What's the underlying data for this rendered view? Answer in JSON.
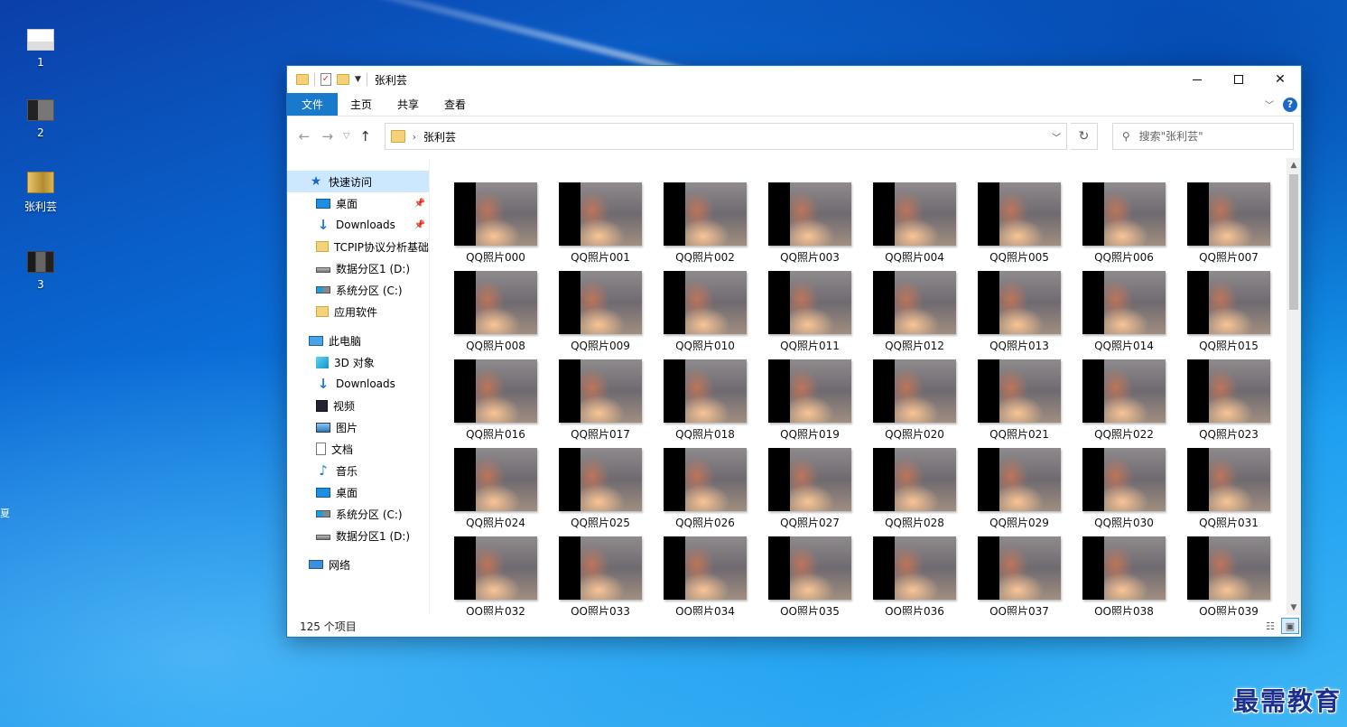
{
  "desktop": {
    "icons": [
      {
        "label": "1"
      },
      {
        "label": "2"
      },
      {
        "label": "张利芸"
      },
      {
        "label": "3"
      }
    ],
    "edge_text": [
      "夏"
    ],
    "watermark": "最需教育"
  },
  "window": {
    "title": "张利芸",
    "ribbon_tabs": [
      "文件",
      "主页",
      "共享",
      "查看"
    ],
    "help_label": "?",
    "address": {
      "path": "张利芸"
    },
    "search": {
      "placeholder": "搜索\"张利芸\""
    },
    "sidebar": {
      "quick_access": "快速访问",
      "quick_items": [
        {
          "label": "桌面",
          "icon": "desktop-icon",
          "pinned": true
        },
        {
          "label": "Downloads",
          "icon": "downloads-icon",
          "pinned": true
        },
        {
          "label": "TCPIP协议分析基础",
          "icon": "folder-icon",
          "pinned": false
        },
        {
          "label": "数据分区1 (D:)",
          "icon": "drive-icon",
          "pinned": false
        },
        {
          "label": "系统分区 (C:)",
          "icon": "system-drive-icon",
          "pinned": false
        },
        {
          "label": "应用软件",
          "icon": "folder-icon",
          "pinned": false
        }
      ],
      "this_pc": "此电脑",
      "pc_items": [
        {
          "label": "3D 对象",
          "icon": "3d-objects-icon"
        },
        {
          "label": "Downloads",
          "icon": "downloads-icon"
        },
        {
          "label": "视频",
          "icon": "video-icon"
        },
        {
          "label": "图片",
          "icon": "pictures-icon"
        },
        {
          "label": "文档",
          "icon": "documents-icon"
        },
        {
          "label": "音乐",
          "icon": "music-icon"
        },
        {
          "label": "桌面",
          "icon": "desktop-icon"
        },
        {
          "label": "系统分区 (C:)",
          "icon": "system-drive-icon"
        },
        {
          "label": "数据分区1 (D:)",
          "icon": "drive-icon"
        }
      ],
      "network": "网络"
    },
    "files": [
      "QQ照片000",
      "QQ照片001",
      "QQ照片002",
      "QQ照片003",
      "QQ照片004",
      "QQ照片005",
      "QQ照片006",
      "QQ照片007",
      "QQ照片008",
      "QQ照片009",
      "QQ照片010",
      "QQ照片011",
      "QQ照片012",
      "QQ照片013",
      "QQ照片014",
      "QQ照片015",
      "QQ照片016",
      "QQ照片017",
      "QQ照片018",
      "QQ照片019",
      "QQ照片020",
      "QQ照片021",
      "QQ照片022",
      "QQ照片023",
      "QQ照片024",
      "QQ照片025",
      "QQ照片026",
      "QQ照片027",
      "QQ照片028",
      "QQ照片029",
      "QQ照片030",
      "QQ照片031",
      "QQ照片032",
      "QQ照片033",
      "QQ照片034",
      "QQ照片035",
      "QQ照片036",
      "QQ照片037",
      "QQ照片038",
      "QQ照片039"
    ],
    "status": {
      "item_count": "125 个项目"
    },
    "colors": {
      "accent": "#1979ca",
      "selection": "#cce8ff"
    }
  }
}
